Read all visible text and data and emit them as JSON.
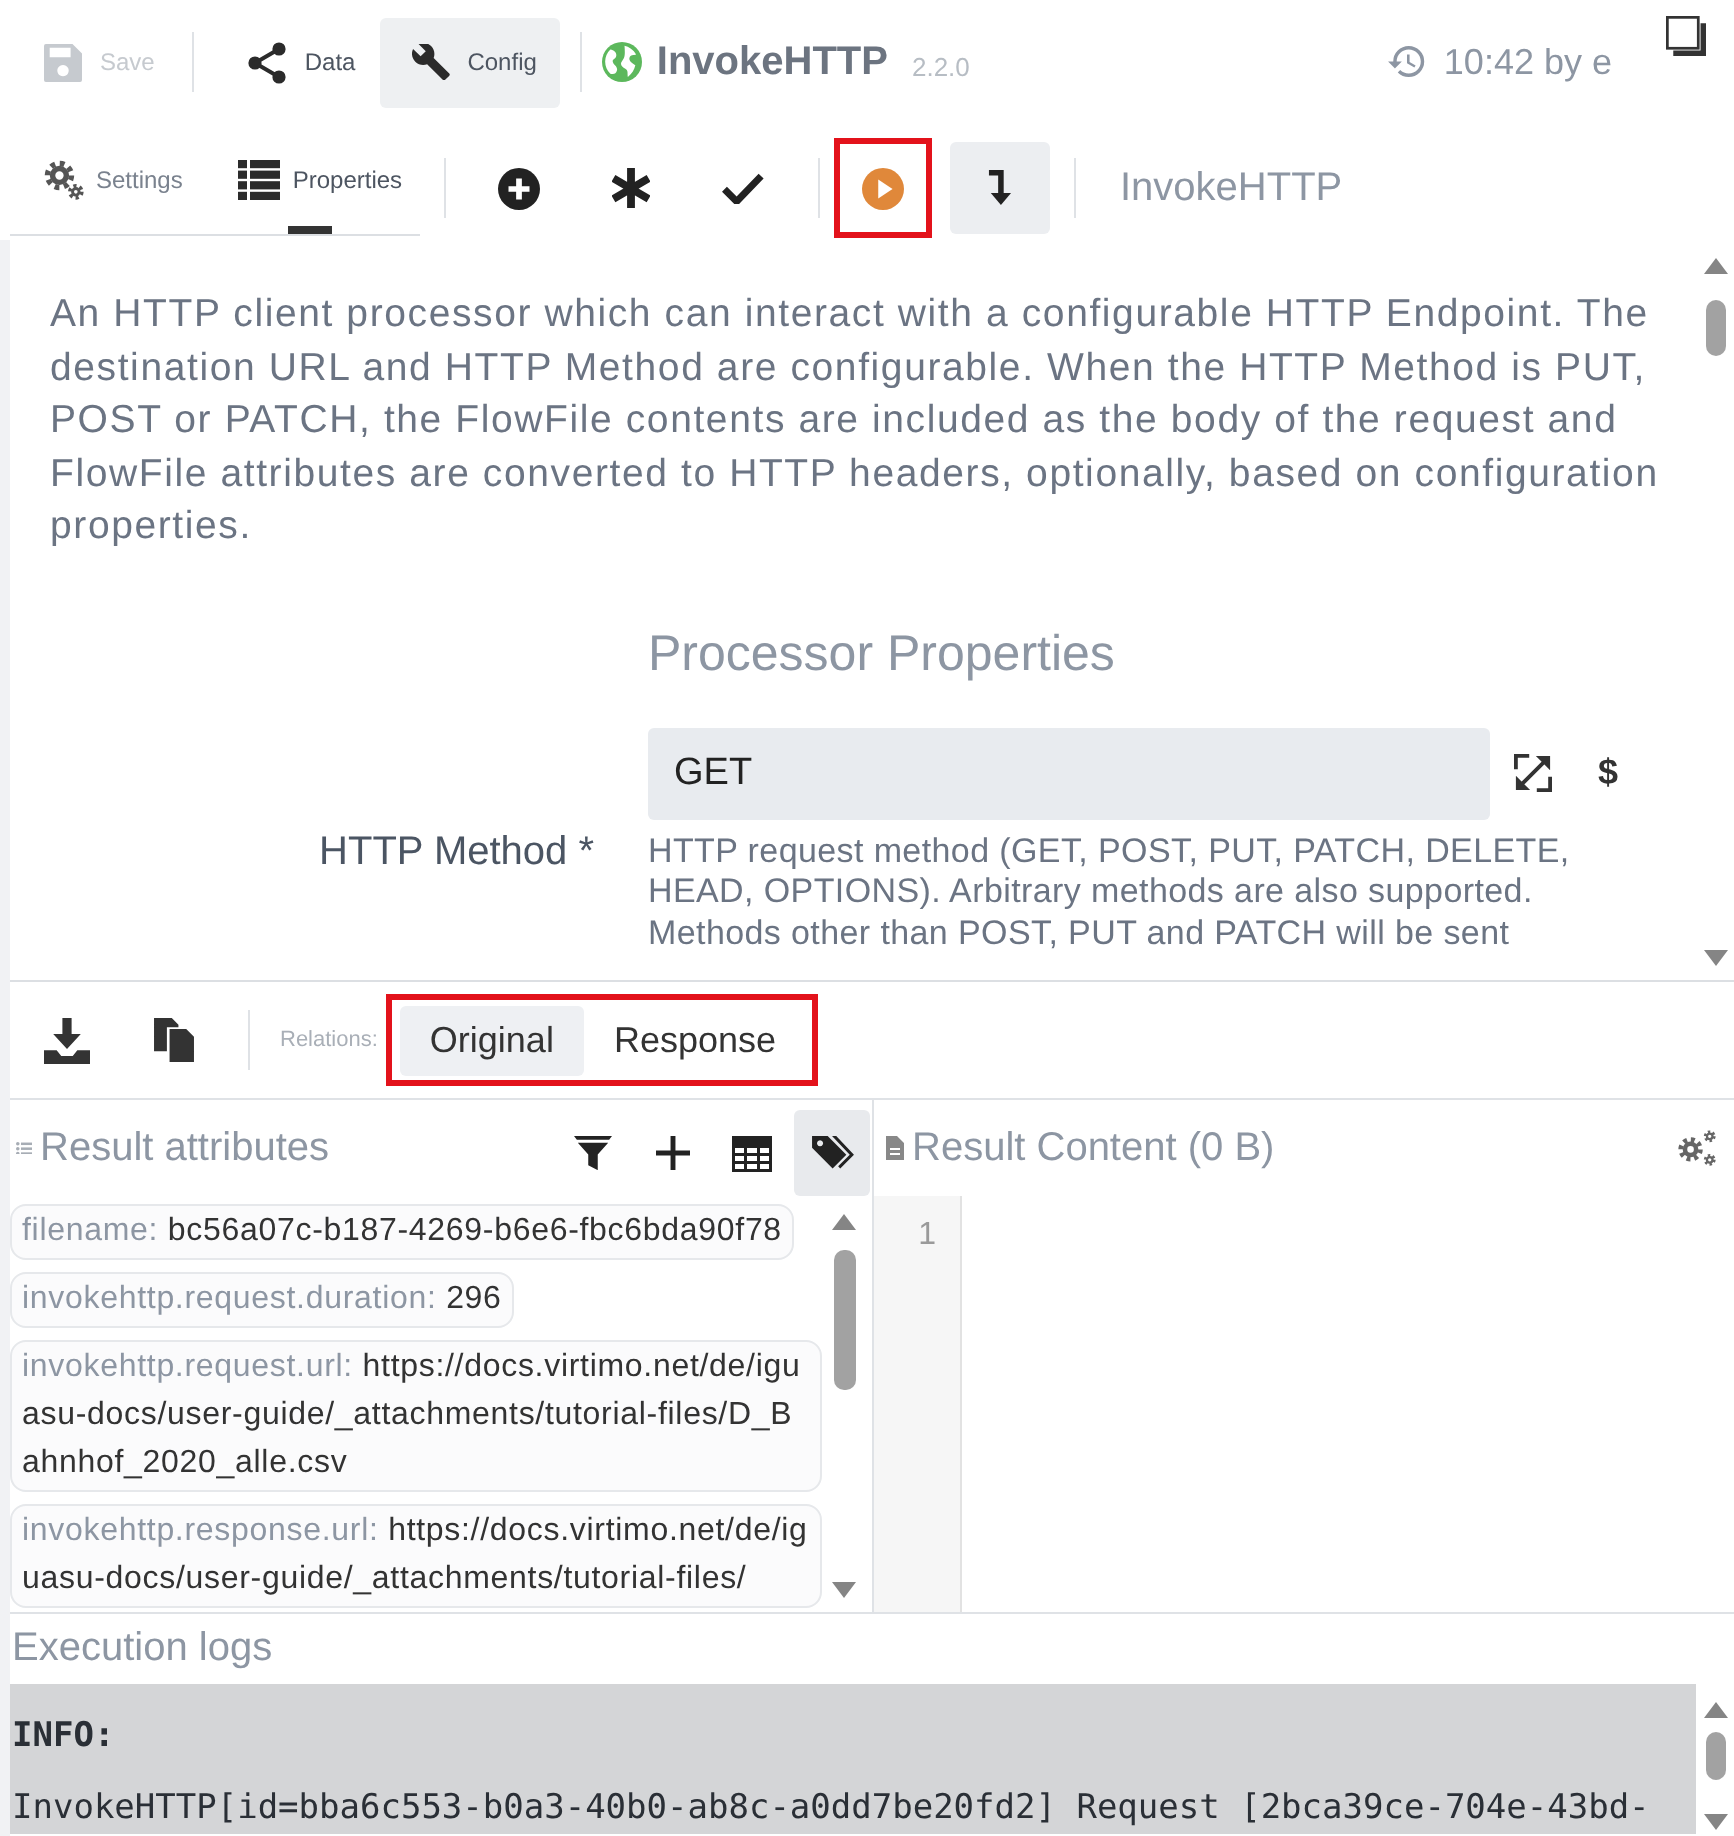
{
  "toolbar": {
    "buttons": [
      {
        "kind": "save",
        "label": "Save",
        "disabled": true,
        "selected": false
      },
      {
        "kind": "data",
        "label": "Data",
        "disabled": false,
        "selected": false
      },
      {
        "kind": "config",
        "label": "Config",
        "disabled": false,
        "selected": true
      }
    ],
    "processor": {
      "name": "InvokeHTTP",
      "version": "2.2.0"
    },
    "last_change": "10:42 by e"
  },
  "tabs": [
    {
      "kind": "settings",
      "label": "Settings",
      "selected": false
    },
    {
      "kind": "properties",
      "label": "Properties",
      "selected": true
    }
  ],
  "action_groups": [
    [
      {
        "kind": "add",
        "active": false,
        "highlighted": false
      },
      {
        "kind": "asterisk",
        "active": false,
        "highlighted": false
      },
      {
        "kind": "check",
        "active": false,
        "highlighted": false
      }
    ],
    [
      {
        "kind": "run",
        "active": false,
        "highlighted": true
      },
      {
        "kind": "step",
        "active": true,
        "highlighted": false
      }
    ]
  ],
  "component_name": "InvokeHTTP",
  "description": "An HTTP client processor which can interact with a configurable HTTP Endpoint. The destination URL and HTTP Method are configurable. When the HTTP Method is PUT, POST or PATCH, the FlowFile contents are included as the body of the request and FlowFile attributes are converted to HTTP headers, optionally, based on configuration properties.",
  "processor_properties": {
    "heading": "Processor Properties",
    "items": [
      {
        "label": "HTTP Method *",
        "value": "GET",
        "expression_symbol": "$",
        "help": "HTTP request method (GET, POST, PUT, PATCH, DELETE, HEAD, OPTIONS). Arbitrary methods are also supported. Methods other than POST, PUT and PATCH will be sent"
      }
    ]
  },
  "relations": {
    "label": "Relations:",
    "highlighted": true,
    "options": [
      {
        "label": "Original",
        "selected": true
      },
      {
        "label": "Response",
        "selected": false
      }
    ]
  },
  "result_attributes": {
    "title": "Result attributes",
    "tools": [
      {
        "kind": "filter",
        "selected": false
      },
      {
        "kind": "add",
        "selected": false
      },
      {
        "kind": "table",
        "selected": false
      },
      {
        "kind": "tags",
        "selected": true
      }
    ],
    "items": [
      {
        "key": "filename:",
        "value": "bc56a07c-b187-4269-b6e6-fbc6bda90f78"
      },
      {
        "key": "invokehttp.request.duration:",
        "value": "296"
      },
      {
        "key": "invokehttp.request.url:",
        "value": "https://docs.virtimo.net/de/iguasu-docs/user-guide/_attachments/tutorial-files/D_Bahnhof_2020_alle.csv"
      },
      {
        "key": "invokehttp.response.url:",
        "value": "https://docs.virtimo.net/de/iguasu-docs/user-guide/_attachments/tutorial-files/"
      }
    ]
  },
  "result_content": {
    "title": "Result Content (0 B)",
    "line_numbers": [
      "1"
    ]
  },
  "execution_logs": {
    "title": "Execution logs",
    "entries": [
      {
        "level": "INFO:",
        "message": "InvokeHTTP[id=bba6c553-b0a3-40b0-ab8c-a0dd7be20fd2] Request [2bca39ce-704e-43bd-"
      }
    ]
  }
}
